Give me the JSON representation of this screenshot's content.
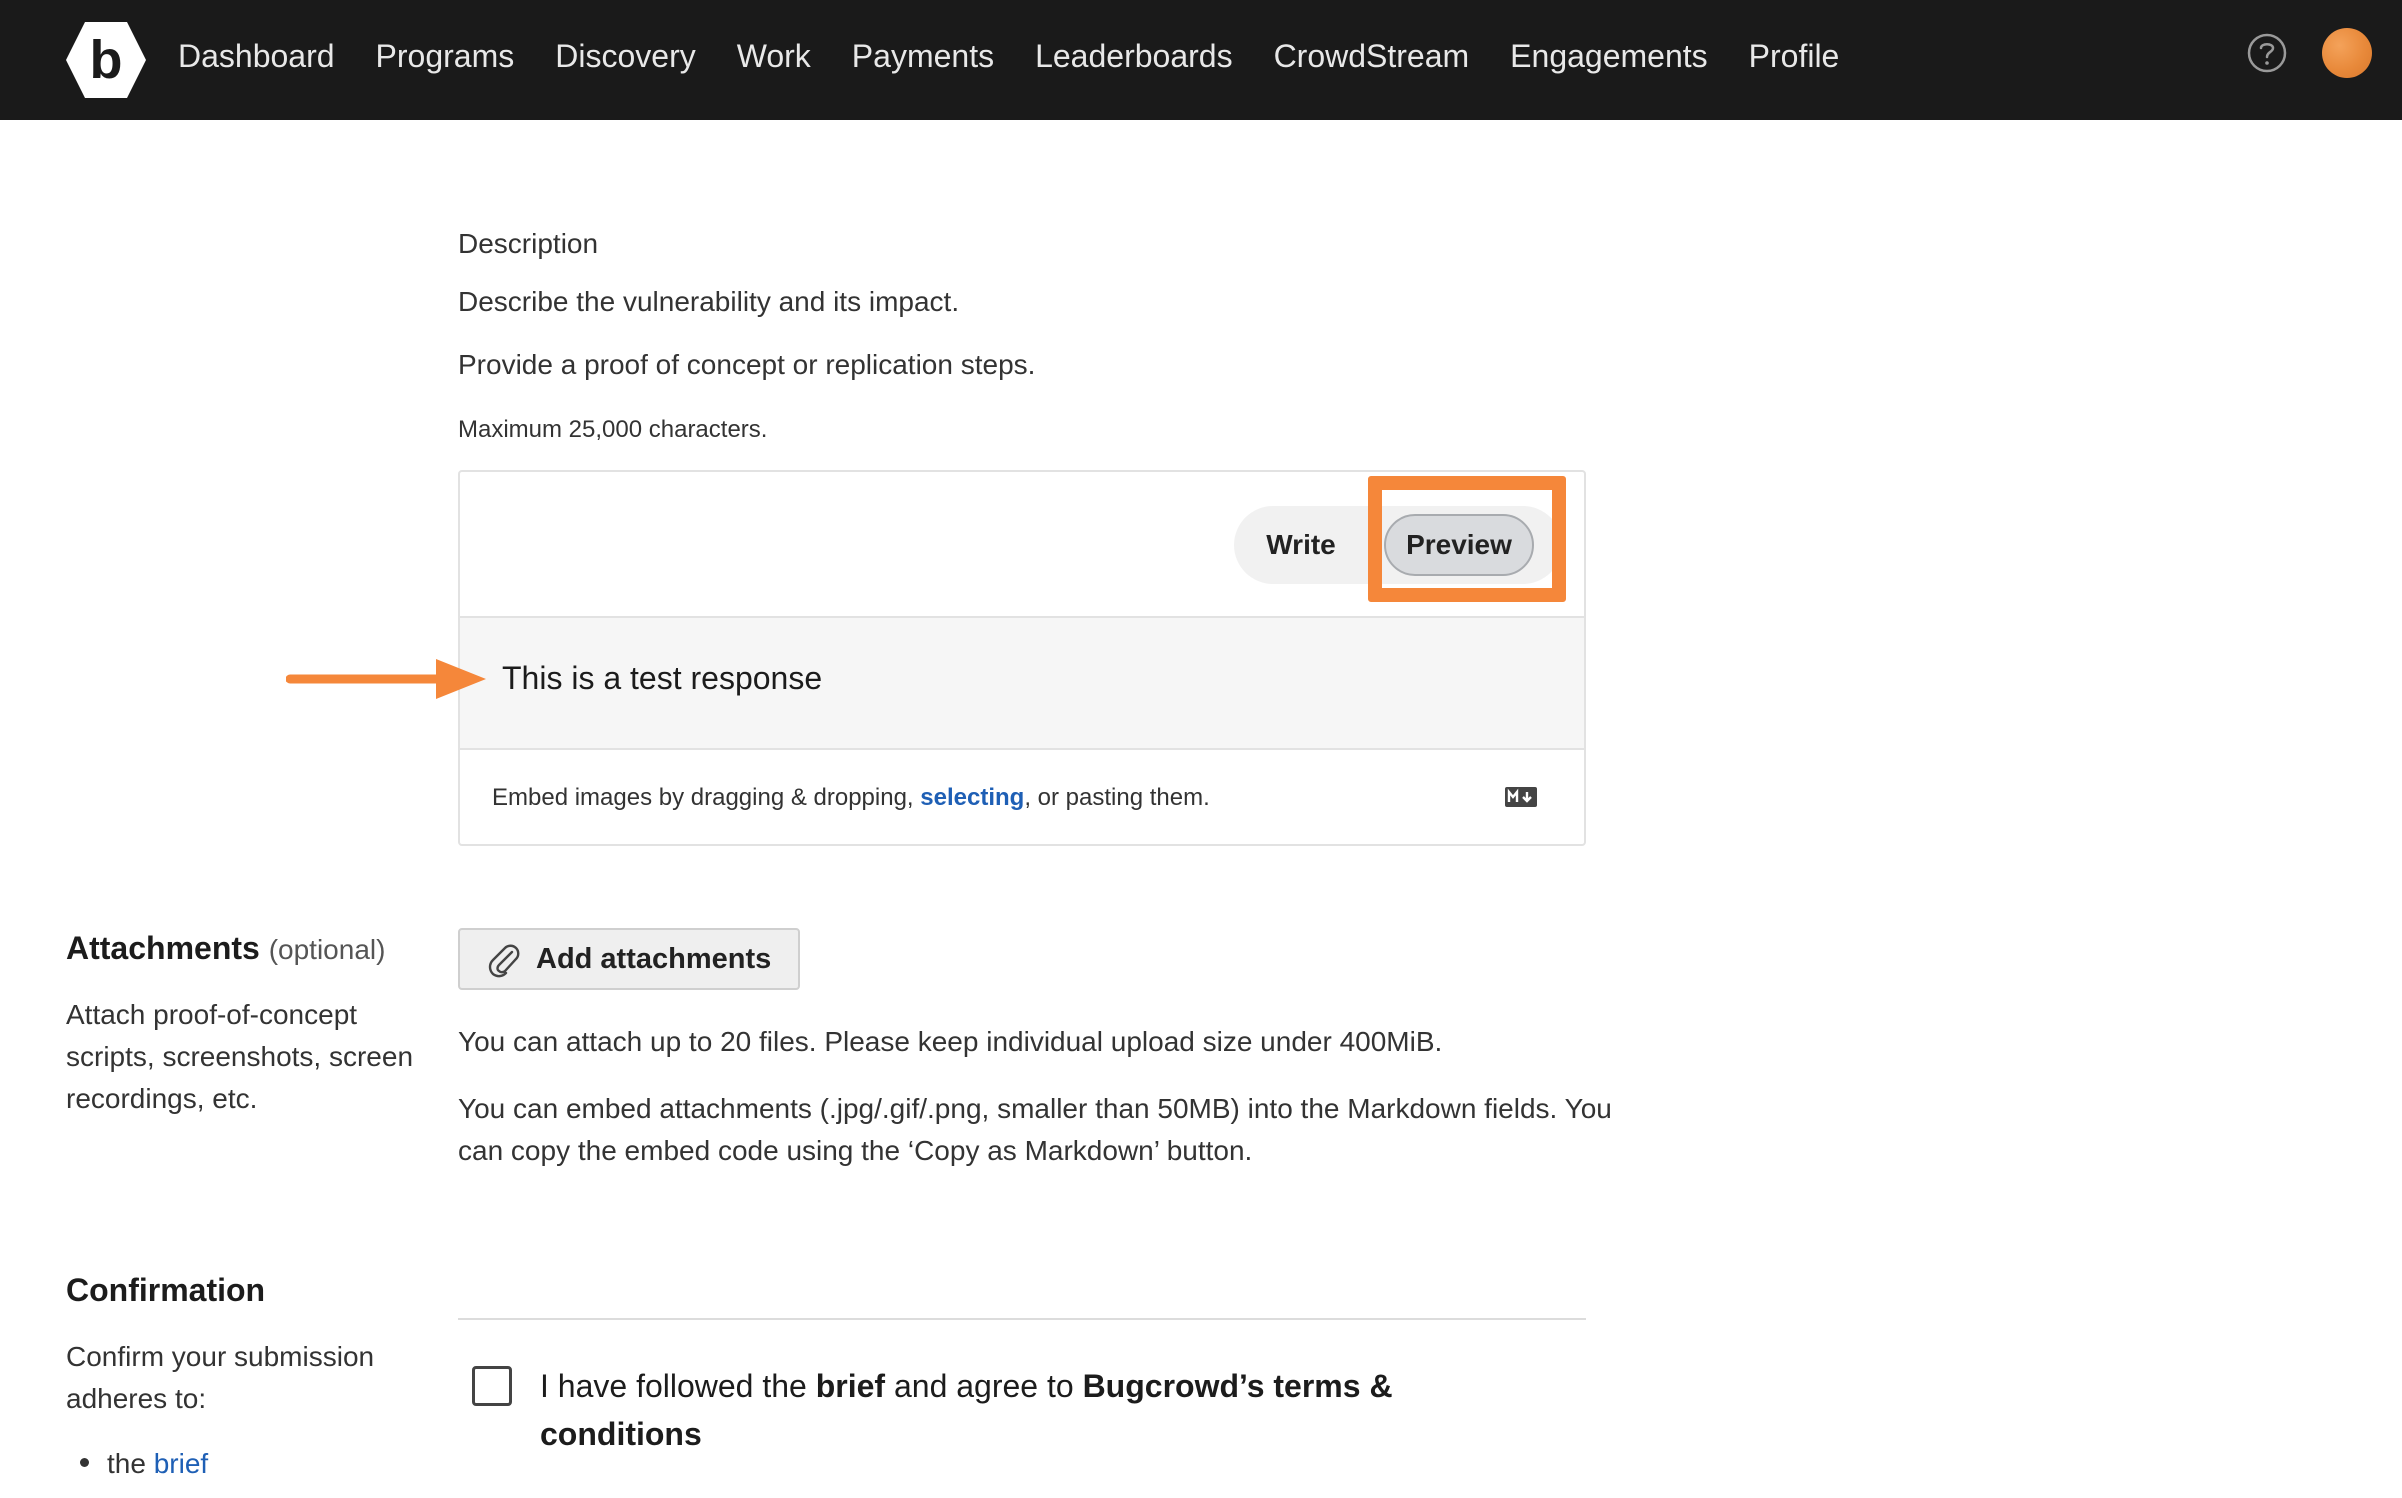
{
  "nav": {
    "logo_letter": "b",
    "items": [
      {
        "label": "Dashboard"
      },
      {
        "label": "Programs"
      },
      {
        "label": "Discovery"
      },
      {
        "label": "Work"
      },
      {
        "label": "Payments"
      },
      {
        "label": "Leaderboards"
      },
      {
        "label": "CrowdStream"
      },
      {
        "label": "Engagements"
      },
      {
        "label": "Profile"
      }
    ],
    "help_icon": "question-circle-icon",
    "avatar_color": "#e8893a"
  },
  "description": {
    "label": "Description",
    "line1": "Describe the vulnerability and its impact.",
    "line2": "Provide a proof of concept or replication steps.",
    "max_chars": "Maximum 25,000 characters.",
    "editor": {
      "write_label": "Write",
      "preview_label": "Preview",
      "active_tab": "Preview",
      "preview_content": "This is a test response",
      "embed_prefix": "Embed images by dragging & dropping, ",
      "embed_link": "selecting",
      "embed_suffix": ", or pasting them.",
      "markdown_icon": "markdown-icon"
    },
    "highlight_color": "#f5873a"
  },
  "attachments": {
    "heading": "Attachments",
    "optional": "(optional)",
    "help": "Attach proof-of-concept scripts, screenshots, screen recordings, etc.",
    "button_label": "Add attachments",
    "button_icon": "paperclip-icon",
    "info1": "You can attach up to 20 files. Please keep individual upload size under 400MiB.",
    "info2": "You can embed attachments (.jpg/.gif/.png, smaller than 50MB) into the Markdown fields. You can copy the embed code using the ‘Copy as Markdown’ button."
  },
  "confirmation": {
    "heading": "Confirmation",
    "help": "Confirm your submission adheres to:",
    "bullet_prefix": "the ",
    "bullet_link": "brief",
    "checkbox_checked": false,
    "label_part1": "I have followed the ",
    "label_brief": "brief",
    "label_part2": " and agree to ",
    "label_terms": "Bugcrowd’s terms & conditions"
  },
  "colors": {
    "nav_bg": "#1a1a1a",
    "link": "#1e5fb5",
    "accent": "#f5873a"
  }
}
